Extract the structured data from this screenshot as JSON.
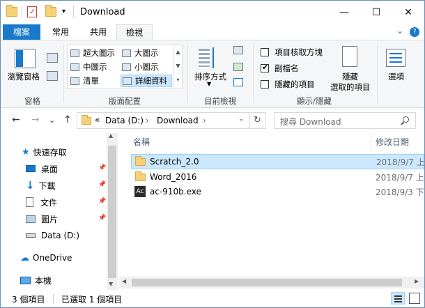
{
  "window": {
    "title": "Download",
    "qat_dropdown": "▾"
  },
  "title_buttons": {
    "minimize": "—",
    "maximize": "☐",
    "close": "✕"
  },
  "tabs": [
    {
      "label": "檔案"
    },
    {
      "label": "常用"
    },
    {
      "label": "共用"
    },
    {
      "label": "檢視"
    }
  ],
  "ribbon_right": {
    "expand": "⌄",
    "help": "?"
  },
  "ribbon": {
    "panes": {
      "preview_pane": "瀏覽窗格",
      "group_label": "窗格"
    },
    "layout": {
      "items": [
        "超大圖示",
        "大圖示",
        "中圖示",
        "小圖示",
        "清單",
        "詳細資料"
      ],
      "group_label": "版面配置"
    },
    "current_view": {
      "sort_label": "排序方式",
      "group_label": "目前檢視"
    },
    "show_hide": {
      "item_checkboxes": "項目核取方塊",
      "extensions": "副檔名",
      "hidden_items": "隱藏的項目",
      "hide_selected_1": "隱藏",
      "hide_selected_2": "選取的項目",
      "options": "選項",
      "group_label": "顯示/隱藏",
      "item_checkboxes_checked": false,
      "extensions_checked": true,
      "hidden_items_checked": false
    }
  },
  "nav": {
    "back": "←",
    "forward": "→",
    "recent": "⌄",
    "up": "↑",
    "path_prefix": "«",
    "path": [
      "Data (D:)",
      "Download"
    ],
    "sep": "›",
    "refresh": "↻",
    "search_placeholder": "搜尋 Download"
  },
  "navpane": {
    "items": [
      {
        "label": "快速存取"
      },
      {
        "label": "桌面"
      },
      {
        "label": "下載"
      },
      {
        "label": "文件"
      },
      {
        "label": "圖片"
      },
      {
        "label": "Data (D:)"
      },
      {
        "label": "OneDrive"
      },
      {
        "label": "本機"
      }
    ]
  },
  "list": {
    "columns": [
      "名稱",
      "修改日期"
    ],
    "sort_indicator": "˄",
    "rows": [
      {
        "name": "Scratch_2.0",
        "date": "2018/9/7 上",
        "selected": true
      },
      {
        "name": "Word_2016",
        "date": "2018/9/7 上",
        "selected": false
      },
      {
        "name": "ac-910b.exe",
        "date": "2018/9/3 下",
        "selected": false
      }
    ]
  },
  "status": {
    "count": "3 個項目",
    "selected": "已選取 1 個項目"
  },
  "colors": {
    "accent": "#1979ca",
    "selection": "#cce8ff",
    "selection_border": "#99d1ff"
  }
}
